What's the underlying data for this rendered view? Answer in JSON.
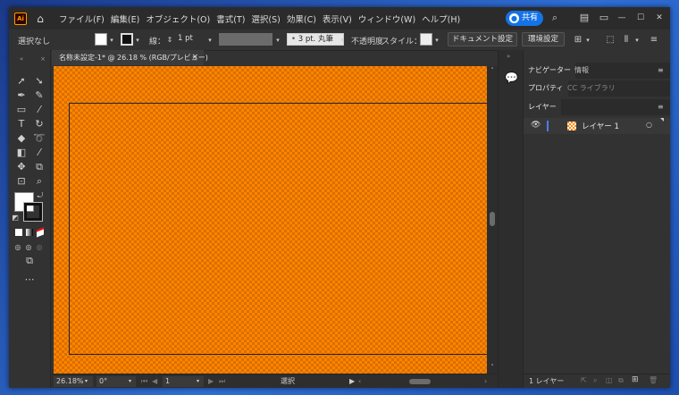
{
  "app": {
    "logo": "Ai"
  },
  "menu": [
    "ファイル(F)",
    "編集(E)",
    "オブジェクト(O)",
    "書式(T)",
    "選択(S)",
    "効果(C)",
    "表示(V)",
    "ウィンドウ(W)",
    "ヘルプ(H)"
  ],
  "titlebar": {
    "share_label": "共有",
    "share_icon": "person-icon",
    "minimize": "—",
    "maximize": "☐",
    "close": "✕"
  },
  "control_bar": {
    "selection_label": "選択なし",
    "stroke_label": "線：",
    "stroke_value": "1 pt",
    "brush_label": "3 pt. 丸筆",
    "opacity_label": "不透明度",
    "style_label": "スタイル：",
    "document_setup": "ドキュメント設定",
    "preferences": "環境設定"
  },
  "document": {
    "tab_title": "名称未設定-1* @ 26.18 % (RGB/プレビュー)",
    "close": "×"
  },
  "status_bar": {
    "zoom": "26.18%",
    "rotation": "0°",
    "artboard": "1",
    "tool": "選択"
  },
  "panels": {
    "tab_navigator": "ナビゲーター",
    "tab_info": "情報",
    "tab_properties": "プロパティ",
    "tab_libraries": "CC ライブラリ",
    "tab_layers": "レイヤー",
    "layer_name": "レイヤー 1",
    "footer_count": "1 レイヤー"
  },
  "colors": {
    "accent": "#1473e6",
    "canvas_orange": "#ff8400",
    "canvas_dark": "#d96f00",
    "layer_color": "#4a7cff"
  }
}
